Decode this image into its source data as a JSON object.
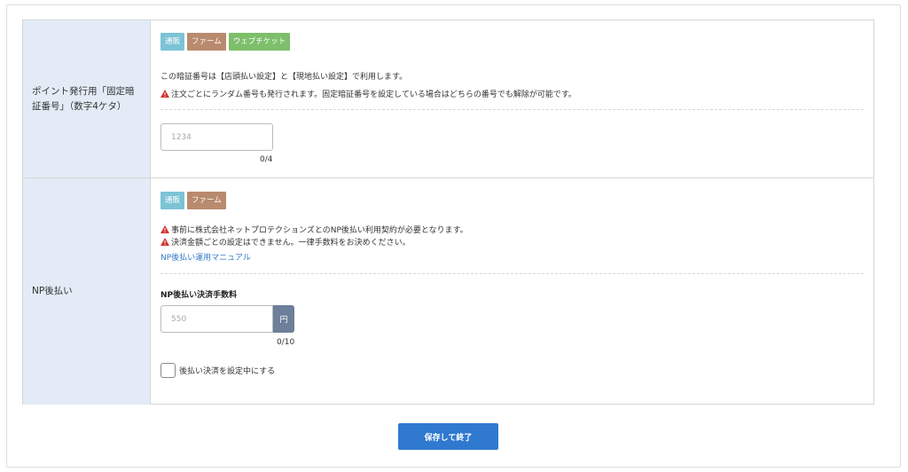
{
  "rows": [
    {
      "label": "ポイント発行用「固定暗証番号」（数字4ケタ）",
      "badges": [
        "通販",
        "ファーム",
        "ウェブチケット"
      ],
      "description": "この暗証番号は【店頭払い設定】と【現地払い設定】で利用します。",
      "warnings": [
        "注文ごとにランダム番号も発行されます。固定暗証番号を設定している場合はどちらの番号でも解除が可能です。"
      ],
      "input": {
        "placeholder": "1234",
        "value": "",
        "counter": "0/4"
      }
    },
    {
      "label": "NP後払い",
      "badges": [
        "通販",
        "ファーム"
      ],
      "warnings": [
        "事前に株式会社ネットプロテクションズとのNP後払い利用契約が必要となります。",
        "決済金額ごとの設定はできません。一律手数料をお決めください。"
      ],
      "manual_link": "NP後払い運用マニュアル",
      "fee_label": "NP後払い決済手数料",
      "input": {
        "placeholder": "550",
        "value": "",
        "unit": "円",
        "counter": "0/10"
      },
      "checkbox": {
        "label": "後払い決済を設定中にする",
        "checked": false
      }
    }
  ],
  "submit_label": "保存して終了",
  "colors": {
    "accent": "#2f79d0",
    "label_bg": "#e3ecf6",
    "warning": "#d0342c",
    "link": "#2f79c8"
  }
}
